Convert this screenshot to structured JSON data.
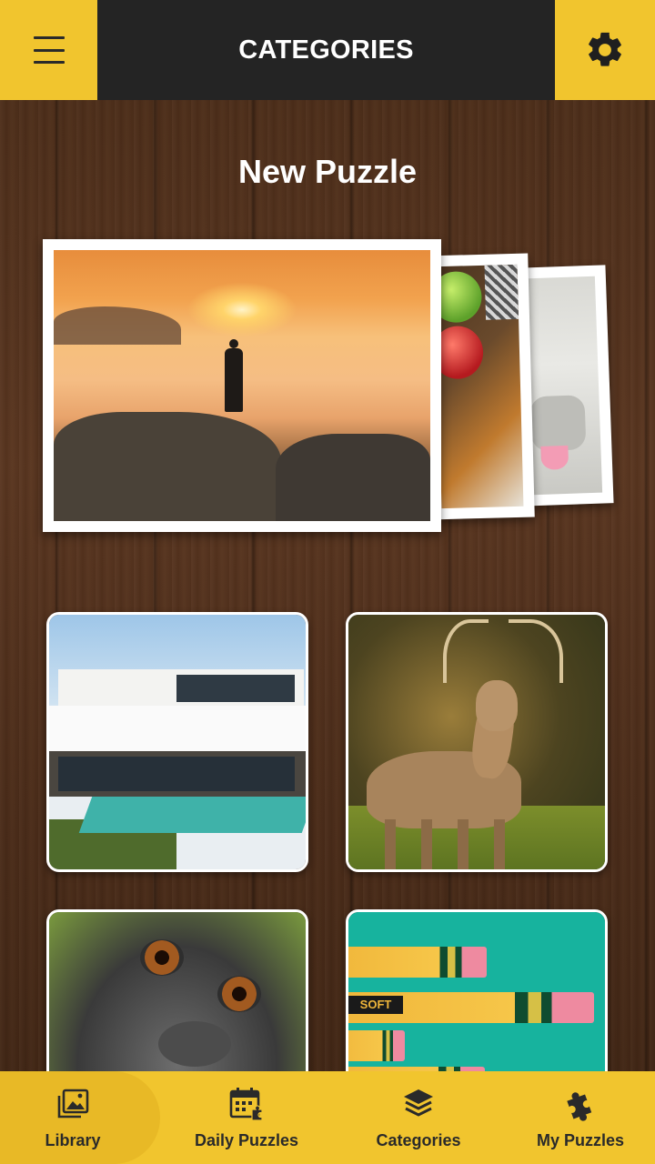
{
  "header": {
    "title": "CATEGORIES",
    "menu_icon": "hamburger-menu-icon",
    "settings_icon": "gear-icon"
  },
  "new_puzzle": {
    "title": "New Puzzle",
    "cards": [
      "sunset-cliff-photo",
      "apples-photo",
      "goat-photo"
    ]
  },
  "categories": [
    {
      "image": "modern-house-photo"
    },
    {
      "image": "deer-photo"
    },
    {
      "image": "monkey-photo"
    },
    {
      "image": "pencils-photo"
    }
  ],
  "bottom_nav": {
    "active": "Library",
    "items": [
      {
        "label": "Library",
        "icon": "gallery-icon"
      },
      {
        "label": "Daily Puzzles",
        "icon": "calendar-puzzle-icon"
      },
      {
        "label": "Categories",
        "icon": "layers-icon"
      },
      {
        "label": "My Puzzles",
        "icon": "puzzle-piece-icon"
      }
    ]
  },
  "colors": {
    "accent_yellow": "#f1c52e",
    "header_dark": "#242424",
    "text_dark": "#2a2a2a",
    "text_light": "#ffffff"
  }
}
